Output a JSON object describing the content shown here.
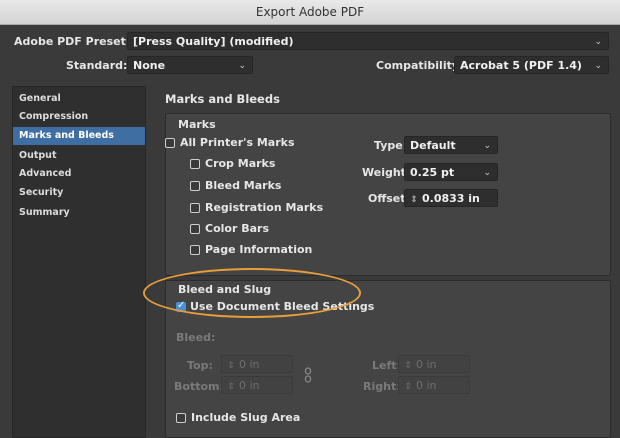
{
  "window": {
    "title": "Export Adobe PDF"
  },
  "preset": {
    "label": "Adobe PDF Preset:",
    "value": "[Press Quality] (modified)"
  },
  "standard": {
    "label": "Standard:",
    "value": "None"
  },
  "compatibility": {
    "label": "Compatibility:",
    "value": "Acrobat 5 (PDF 1.4)"
  },
  "sidebar": {
    "items": [
      {
        "label": "General"
      },
      {
        "label": "Compression"
      },
      {
        "label": "Marks and Bleeds"
      },
      {
        "label": "Output"
      },
      {
        "label": "Advanced"
      },
      {
        "label": "Security"
      },
      {
        "label": "Summary"
      }
    ],
    "selected": "Marks and Bleeds"
  },
  "main": {
    "section_title": "Marks and Bleeds",
    "marks": {
      "title": "Marks",
      "all_printers": "All Printer's Marks",
      "crop": "Crop Marks",
      "bleed": "Bleed Marks",
      "registration": "Registration Marks",
      "color_bars": "Color Bars",
      "page_info": "Page Information",
      "type_label": "Type:",
      "type_value": "Default",
      "weight_label": "Weight:",
      "weight_value": "0.25 pt",
      "offset_label": "Offset:",
      "offset_value": "0.0833 in"
    },
    "bleed_slug": {
      "title": "Bleed and Slug",
      "use_doc": "Use Document Bleed Settings",
      "use_doc_checked": true,
      "bleed_label": "Bleed:",
      "top_label": "Top:",
      "top_value": "0 in",
      "bottom_label": "Bottom:",
      "bottom_value": "0 in",
      "left_label": "Left:",
      "left_value": "0 in",
      "right_label": "Right:",
      "right_value": "0 in",
      "include_slug": "Include Slug Area"
    }
  },
  "colors": {
    "selection": "#3f6ea2",
    "highlight_ellipse": "#e89f3a",
    "checkbox_on": "#4a90d9"
  },
  "icons": {
    "dropdown": "chevron-down-icon",
    "stepper": "stepper-icon",
    "chain": "link-chain-icon",
    "check": "check-icon"
  }
}
